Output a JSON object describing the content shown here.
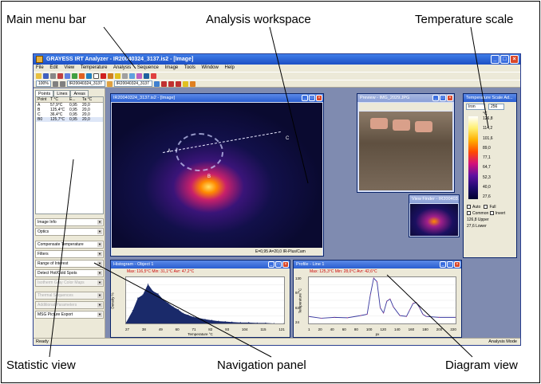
{
  "callouts": {
    "main_menu_bar": "Main menu bar",
    "analysis_workspace": "Analysis workspace",
    "temperature_scale": "Temperature scale",
    "statistic_view": "Statistic view",
    "navigation_panel": "Navigation panel",
    "diagram_view": "Diagram view"
  },
  "app": {
    "title": "GRAYESS IRT Analyzer - IR20040324_3137.is2 - [Image]",
    "menu": [
      "File",
      "Edit",
      "View",
      "Temperature",
      "Analysis",
      "Sequence",
      "Image",
      "Tools",
      "Window",
      "Help"
    ],
    "zoom": "100%",
    "file_combo_1": "IR20040324_3137",
    "file_combo_2": "IR20040324_3137",
    "status_left": "Ready",
    "status_right": "Analysis Mode"
  },
  "left_panel": {
    "tabs": [
      "Points",
      "Lines",
      "Areas"
    ],
    "columns": [
      "Point",
      "T °C",
      "E...",
      "Ta °C"
    ],
    "rows": [
      {
        "point": "A",
        "t": "57,9°C",
        "e": "0,95",
        "ta": "20,0"
      },
      {
        "point": "B",
        "t": "125,4°C",
        "e": "0,95",
        "ta": "20,0"
      },
      {
        "point": "C",
        "t": "36,4°C",
        "e": "0,95",
        "ta": "20,0"
      },
      {
        "point": "B0",
        "t": "125,7°C",
        "e": "0,95",
        "ta": "20,0"
      }
    ],
    "nav_items": [
      {
        "label": "Image Info",
        "disabled": false
      },
      {
        "label": "Optics",
        "disabled": false
      },
      {
        "label": "Compensate Temperature",
        "disabled": false
      },
      {
        "label": "Filters",
        "disabled": false
      },
      {
        "label": "Range of Interest",
        "disabled": false
      },
      {
        "label": "Detect Hot/Cold Spots",
        "disabled": false
      },
      {
        "label": "Isotherm Gray Color Maps",
        "disabled": true
      },
      {
        "label": "Thermal Sequences",
        "disabled": true
      },
      {
        "label": "Additional Parameters",
        "disabled": true
      },
      {
        "label": "MSG Picture Export",
        "disabled": false
      }
    ]
  },
  "image_window": {
    "title": "IR20040324_3137.is2 - [Image]",
    "markers": {
      "a": "A",
      "b": "B",
      "c": "C"
    },
    "status": "E=0,95  A=20,0   IR-Plus/Cam"
  },
  "preview_window": {
    "title": "Preview - IMG_2029.JPG"
  },
  "view_finder_window": {
    "title": "View Finder - IR200403..."
  },
  "scale_window": {
    "title": "Temperature Scale Ad...",
    "palette": "Iron",
    "steps": "256",
    "unit": "°C",
    "ticks": [
      "126,8",
      "114,2",
      "101,6",
      "89,0",
      "77,1",
      "64,7",
      "52,3",
      "40,0",
      "27,6"
    ],
    "options": [
      "Auto",
      "Full",
      "Common",
      "Invert"
    ],
    "upper_value": "126,8",
    "upper_label": "Upper",
    "lower_value": "27,6",
    "lower_label": "Lower"
  },
  "histogram_window": {
    "title": "Histogram - Object 1",
    "legend": "Max: 116,5°C   Min: 31,1°C   Avr: 47,2°C",
    "xlabel": "Temperature °C",
    "ylabel": "Density %"
  },
  "profile_window": {
    "title": "Profile - Line 1",
    "legend": "Max: 125,3°C   Min: 28,0°C   Avr: 42,6°C",
    "xlabel": "px",
    "ylabel": "Temperature °C"
  },
  "chart_data": [
    {
      "type": "area",
      "title": "Histogram - Object 1",
      "xlabel": "Temperature °C",
      "ylabel": "Density %",
      "x_ticks": [
        "27",
        "38",
        "49",
        "60",
        "71",
        "82",
        "93",
        "104",
        "115",
        "121"
      ],
      "y_ticks": [
        "",
        "",
        ""
      ],
      "xlim": [
        27,
        121
      ],
      "x": [
        27,
        31,
        34,
        37,
        40,
        43,
        46,
        49,
        52,
        55,
        58,
        61,
        64,
        67,
        70,
        74,
        78,
        82,
        86,
        90,
        95,
        100,
        105,
        110,
        115,
        121
      ],
      "values": [
        2,
        28,
        55,
        62,
        85,
        70,
        64,
        52,
        44,
        36,
        30,
        22,
        18,
        14,
        12,
        9,
        7,
        5,
        4,
        3,
        2,
        2,
        1,
        1,
        0,
        0
      ],
      "ylim": [
        0,
        100
      ]
    },
    {
      "type": "line",
      "title": "Profile - Line 1",
      "xlabel": "px",
      "ylabel": "Temperature °C",
      "x_ticks": [
        "1",
        "20",
        "40",
        "60",
        "80",
        "100",
        "120",
        "140",
        "160",
        "180",
        "200",
        "220"
      ],
      "y_ticks": [
        "130",
        "97",
        "63",
        "24"
      ],
      "xlim": [
        1,
        225
      ],
      "ylim": [
        24,
        130
      ],
      "x": [
        1,
        20,
        40,
        60,
        80,
        90,
        95,
        100,
        105,
        110,
        115,
        120,
        125,
        130,
        140,
        150,
        155,
        160,
        165,
        170,
        175,
        180,
        200,
        225
      ],
      "values": [
        40,
        36,
        38,
        37,
        42,
        45,
        90,
        128,
        120,
        60,
        48,
        75,
        80,
        62,
        42,
        40,
        55,
        70,
        72,
        60,
        45,
        40,
        38,
        38
      ]
    }
  ]
}
